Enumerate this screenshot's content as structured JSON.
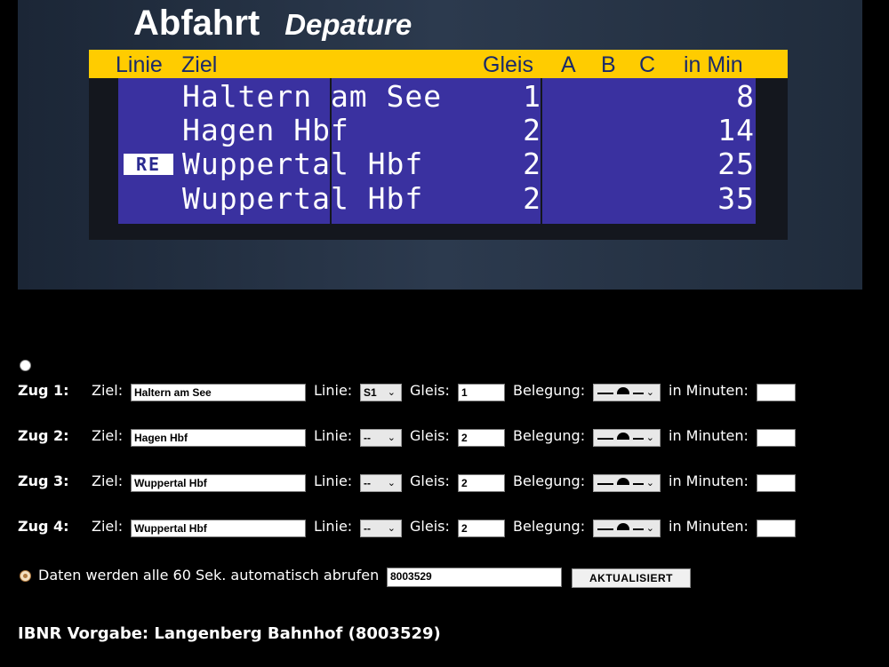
{
  "board": {
    "title": "Abfahrt",
    "subtitle": "Depature",
    "headers": {
      "linie": "Linie",
      "ziel": "Ziel",
      "gleis": "Gleis",
      "a": "A",
      "b": "B",
      "c": "C",
      "in_min": "in Min"
    },
    "rows": [
      {
        "line": "",
        "ziel": "Haltern am See",
        "gleis": "1",
        "min": "8"
      },
      {
        "line": "",
        "ziel": "Hagen Hbf",
        "gleis": "2",
        "min": "14"
      },
      {
        "line": "RE",
        "ziel": "Wuppertal Hbf",
        "gleis": "2",
        "min": "25"
      },
      {
        "line": "",
        "ziel": "Wuppertal Hbf",
        "gleis": "2",
        "min": "35"
      }
    ]
  },
  "form": {
    "labels": {
      "ziel": "Ziel:",
      "linie": "Linie:",
      "gleis": "Gleis:",
      "belegung": "Belegung:",
      "minuten": "in Minuten:"
    },
    "trains": [
      {
        "label": "Zug 1:",
        "ziel": "Haltern am See",
        "linie": "S1",
        "gleis": "1",
        "minuten": ""
      },
      {
        "label": "Zug 2:",
        "ziel": "Hagen Hbf",
        "linie": "--",
        "gleis": "2",
        "minuten": ""
      },
      {
        "label": "Zug 3:",
        "ziel": "Wuppertal Hbf",
        "linie": "--",
        "gleis": "2",
        "minuten": ""
      },
      {
        "label": "Zug 4:",
        "ziel": "Wuppertal Hbf",
        "linie": "--",
        "gleis": "2",
        "minuten": ""
      }
    ],
    "auto_label": "Daten werden alle 60 Sek. automatisch abrufen",
    "ibnr_value": "8003529",
    "update_button": "AKTUALISIERT"
  },
  "footer": "IBNR Vorgabe: Langenberg Bahnhof (8003529)",
  "icons": {
    "select_chevron": "chevron-down-icon",
    "occupancy": "occupancy-icon"
  },
  "colors": {
    "header_yellow": "#ffcc00",
    "panel_blue": "#3a31a0",
    "header_text": "#1a2a6a"
  }
}
